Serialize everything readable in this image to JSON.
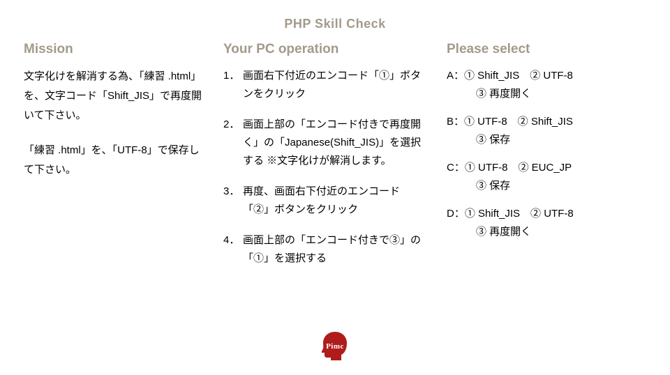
{
  "title": "PHP Skill Check",
  "mission": {
    "heading": "Mission",
    "paragraphs": [
      "文字化けを解消する為、「練習 .html」を、文字コード「Shift_JIS」で再度開いて下さい。",
      "「練習 .html」を、「UTF-8」で保存して下さい。"
    ]
  },
  "operations": {
    "heading": "Your PC operation",
    "items": [
      "画面右下付近のエンコード「①」ボタンをクリック",
      "画面上部の「エンコード付きで再度開く」の「Japanese(Shift_JIS)」を選択する\n※文字化けが解消します。",
      "再度、画面右下付近のエンコード「②」ボタンをクリック",
      "画面上部の「エンコード付きで③」の「①」を選択する"
    ]
  },
  "select": {
    "heading": "Please select",
    "options": [
      {
        "label": "A：",
        "line1": "① Shift_JIS　② UTF-8",
        "line2": "③ 再度開く"
      },
      {
        "label": "B：",
        "line1": "① UTF-8　② Shift_JIS",
        "line2": "③ 保存"
      },
      {
        "label": "C：",
        "line1": "① UTF-8　② EUC_JP",
        "line2": "③ 保存"
      },
      {
        "label": "D：",
        "line1": "① Shift_JIS　② UTF-8",
        "line2": "③ 再度開く"
      }
    ]
  },
  "footer": {
    "brand": "Pimc"
  }
}
